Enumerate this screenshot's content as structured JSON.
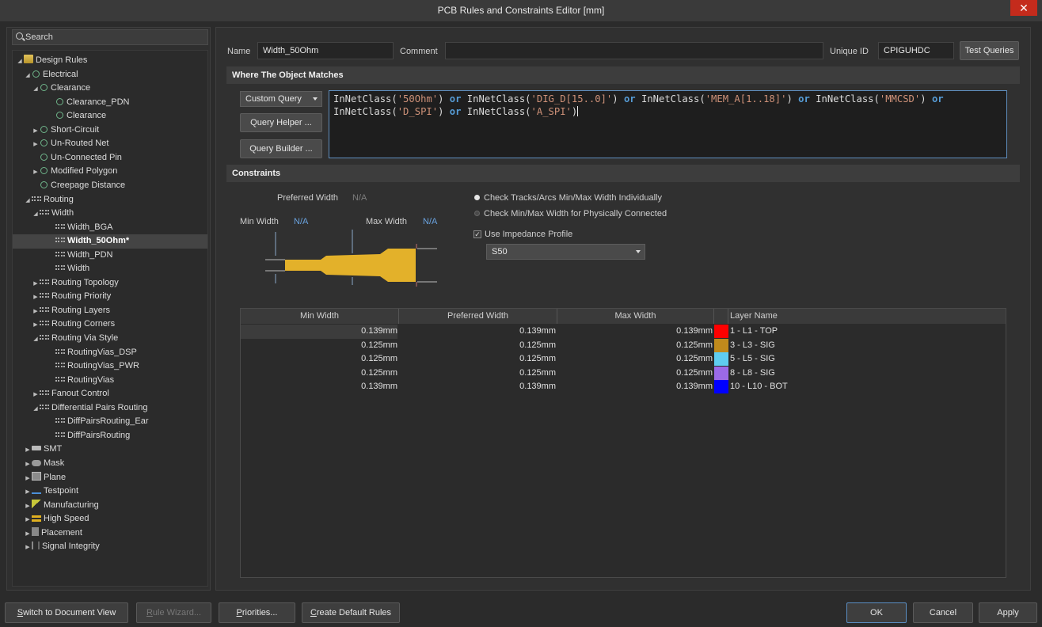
{
  "window": {
    "title": "PCB Rules and Constraints Editor [mm]",
    "close_glyph": "✕"
  },
  "search": {
    "placeholder": "Search"
  },
  "tree": [
    {
      "label": "Design Rules",
      "icon": "folder-icon"
    },
    {
      "label": "Electrical",
      "icon": "electrical-rule-icon"
    },
    {
      "label": "Clearance",
      "icon": "electrical-rule-icon"
    },
    {
      "label": "Clearance_PDN",
      "icon": "electrical-rule-icon"
    },
    {
      "label": "Clearance",
      "icon": "electrical-rule-icon"
    },
    {
      "label": "Short-Circuit",
      "icon": "electrical-rule-icon"
    },
    {
      "label": "Un-Routed Net",
      "icon": "electrical-rule-icon"
    },
    {
      "label": "Un-Connected Pin",
      "icon": "electrical-rule-icon"
    },
    {
      "label": "Modified Polygon",
      "icon": "electrical-rule-icon"
    },
    {
      "label": "Creepage Distance",
      "icon": "electrical-rule-icon"
    },
    {
      "label": "Routing",
      "icon": "routing-rule-icon"
    },
    {
      "label": "Width",
      "icon": "routing-rule-icon"
    },
    {
      "label": "Width_BGA",
      "icon": "routing-rule-icon"
    },
    {
      "label": "Width_50Ohm*",
      "icon": "routing-rule-icon"
    },
    {
      "label": "Width_PDN",
      "icon": "routing-rule-icon"
    },
    {
      "label": "Width",
      "icon": "routing-rule-icon"
    },
    {
      "label": "Routing Topology",
      "icon": "routing-rule-icon"
    },
    {
      "label": "Routing Priority",
      "icon": "routing-rule-icon"
    },
    {
      "label": "Routing Layers",
      "icon": "routing-rule-icon"
    },
    {
      "label": "Routing Corners",
      "icon": "routing-rule-icon"
    },
    {
      "label": "Routing Via Style",
      "icon": "routing-rule-icon"
    },
    {
      "label": "RoutingVias_DSP",
      "icon": "routing-rule-icon"
    },
    {
      "label": "RoutingVias_PWR",
      "icon": "routing-rule-icon"
    },
    {
      "label": "RoutingVias",
      "icon": "routing-rule-icon"
    },
    {
      "label": "Fanout Control",
      "icon": "routing-rule-icon"
    },
    {
      "label": "Differential Pairs Routing",
      "icon": "routing-rule-icon"
    },
    {
      "label": "DiffPairsRouting_Ear",
      "icon": "routing-rule-icon"
    },
    {
      "label": "DiffPairsRouting",
      "icon": "routing-rule-icon"
    },
    {
      "label": "SMT",
      "icon": "smt-icon"
    },
    {
      "label": "Mask",
      "icon": "mask-icon"
    },
    {
      "label": "Plane",
      "icon": "plane-icon"
    },
    {
      "label": "Testpoint",
      "icon": "testpoint-icon"
    },
    {
      "label": "Manufacturing",
      "icon": "manufacturing-icon"
    },
    {
      "label": "High Speed",
      "icon": "high-speed-icon"
    },
    {
      "label": "Placement",
      "icon": "placement-icon"
    },
    {
      "label": "Signal Integrity",
      "icon": "signal-integrity-icon"
    }
  ],
  "rule": {
    "name_label": "Name",
    "name": "Width_50Ohm",
    "comment_label": "Comment",
    "comment": "",
    "uid_label": "Unique ID",
    "uid": "CPIGUHDC",
    "test_queries": "Test Queries"
  },
  "where": {
    "header": "Where The Object Matches",
    "query_type": "Custom Query",
    "helper": "Query Helper ...",
    "builder": "Query Builder ...",
    "query_tokens": [
      {
        "t": "InNetClass(",
        "c": ""
      },
      {
        "t": "'50Ohm'",
        "c": "str"
      },
      {
        "t": ") ",
        "c": ""
      },
      {
        "t": "or",
        "c": "kw"
      },
      {
        "t": " InNetClass(",
        "c": ""
      },
      {
        "t": "'DIG_D[15..0]'",
        "c": "str"
      },
      {
        "t": ") ",
        "c": ""
      },
      {
        "t": "or",
        "c": "kw"
      },
      {
        "t": " InNetClass(",
        "c": ""
      },
      {
        "t": "'MEM_A[1..18]'",
        "c": "str"
      },
      {
        "t": ") ",
        "c": ""
      },
      {
        "t": "or",
        "c": "kw"
      },
      {
        "t": " InNetClass(",
        "c": ""
      },
      {
        "t": "'MMCSD'",
        "c": "str"
      },
      {
        "t": ") ",
        "c": ""
      },
      {
        "t": "or",
        "c": "kw"
      },
      {
        "t": " InNetClass(",
        "c": ""
      },
      {
        "t": "'D_SPI'",
        "c": "str"
      },
      {
        "t": ") ",
        "c": ""
      },
      {
        "t": "or",
        "c": "kw"
      },
      {
        "t": " InNetClass(",
        "c": ""
      },
      {
        "t": "'A_SPI'",
        "c": "str"
      },
      {
        "t": ")",
        "c": ""
      }
    ]
  },
  "constraints": {
    "header": "Constraints",
    "preferred_label": "Preferred Width",
    "preferred_value": "N/A",
    "min_label": "Min Width",
    "min_value": "N/A",
    "max_label": "Max Width",
    "max_value": "N/A",
    "opt1": "Check Tracks/Arcs Min/Max Width Individually",
    "opt2": "Check Min/Max Width for Physically Connected",
    "use_impedance": "Use Impedance Profile",
    "profile": "S50",
    "check_glyph": "✓"
  },
  "table": {
    "headers": [
      "Min Width",
      "Preferred Width",
      "Max Width",
      "Layer Name"
    ],
    "rows": [
      {
        "min": "0.139mm",
        "pref": "0.139mm",
        "max": "0.139mm",
        "color": "#ff0000",
        "layer": "1 - L1 - TOP"
      },
      {
        "min": "0.125mm",
        "pref": "0.125mm",
        "max": "0.125mm",
        "color": "#c08a1c",
        "layer": "3 - L3 - SIG"
      },
      {
        "min": "0.125mm",
        "pref": "0.125mm",
        "max": "0.125mm",
        "color": "#5fcdf0",
        "layer": "5 - L5 - SIG"
      },
      {
        "min": "0.125mm",
        "pref": "0.125mm",
        "max": "0.125mm",
        "color": "#9b6ae8",
        "layer": "8 - L8 - SIG"
      },
      {
        "min": "0.139mm",
        "pref": "0.139mm",
        "max": "0.139mm",
        "color": "#0000ff",
        "layer": "10 - L10 - BOT"
      }
    ]
  },
  "footer": {
    "switch_u": "S",
    "switch_rest": "witch to Document View",
    "wizard_u": "R",
    "wizard_rest": "ule Wizard...",
    "priorities_u": "P",
    "priorities_rest": "riorities...",
    "create_u": "C",
    "create_rest": "reate Default Rules",
    "ok": "OK",
    "cancel": "Cancel",
    "apply": "Apply"
  }
}
